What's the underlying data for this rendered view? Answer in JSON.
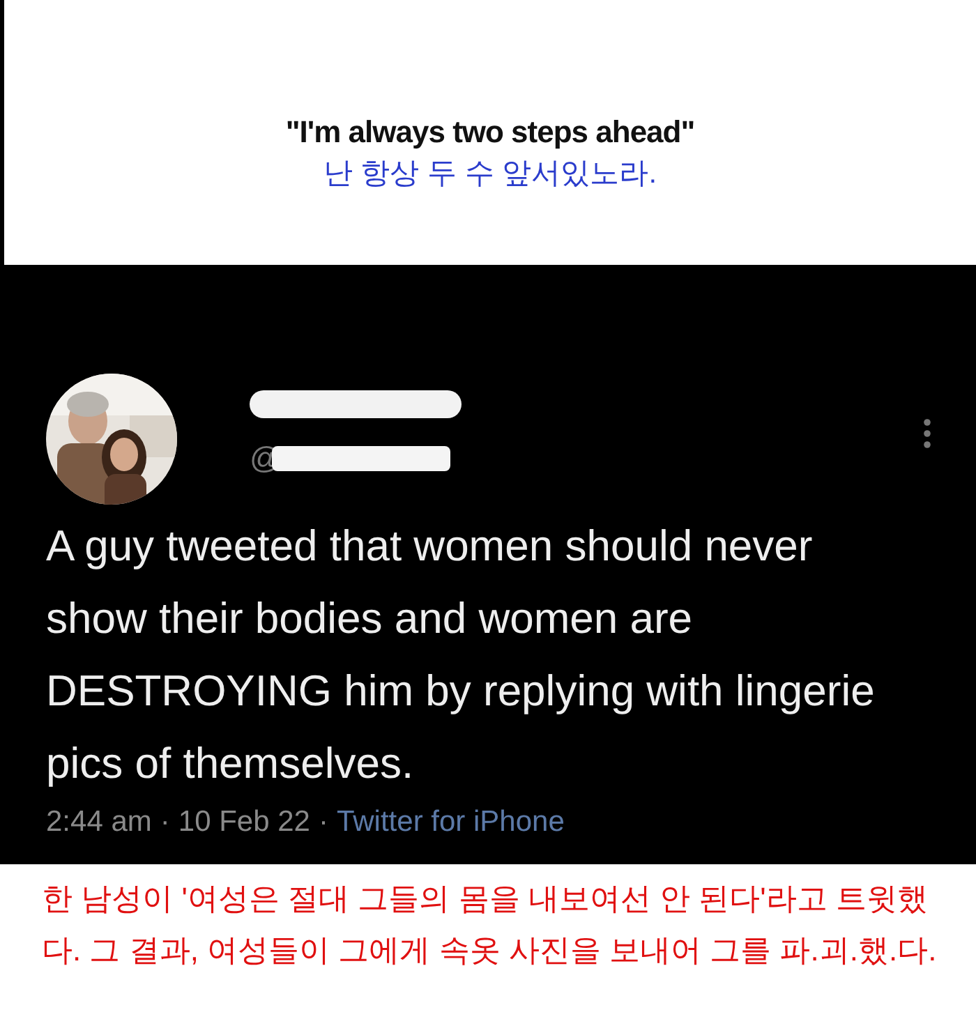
{
  "caption": {
    "quote": "\"I'm always two steps ahead\"",
    "translation": "난 항상 두 수 앞서있노라."
  },
  "tweet": {
    "author": {
      "handle": "@"
    },
    "text": "A guy tweeted that women should never show their bodies and women are DESTROYING him by replying with lingerie pics of themselves.",
    "time": "2:44 am",
    "separator_1": "·",
    "date": "10 Feb 22",
    "separator_2": "·",
    "source": "Twitter for iPhone"
  },
  "footer": {
    "translation": "한 남성이 '여성은 절대 그들의 몸을 내보여선 안 된다'라고 트윗했다. 그 결과, 여성들이 그에게 속옷 사진을 보내어 그를 파.괴.했.다."
  }
}
